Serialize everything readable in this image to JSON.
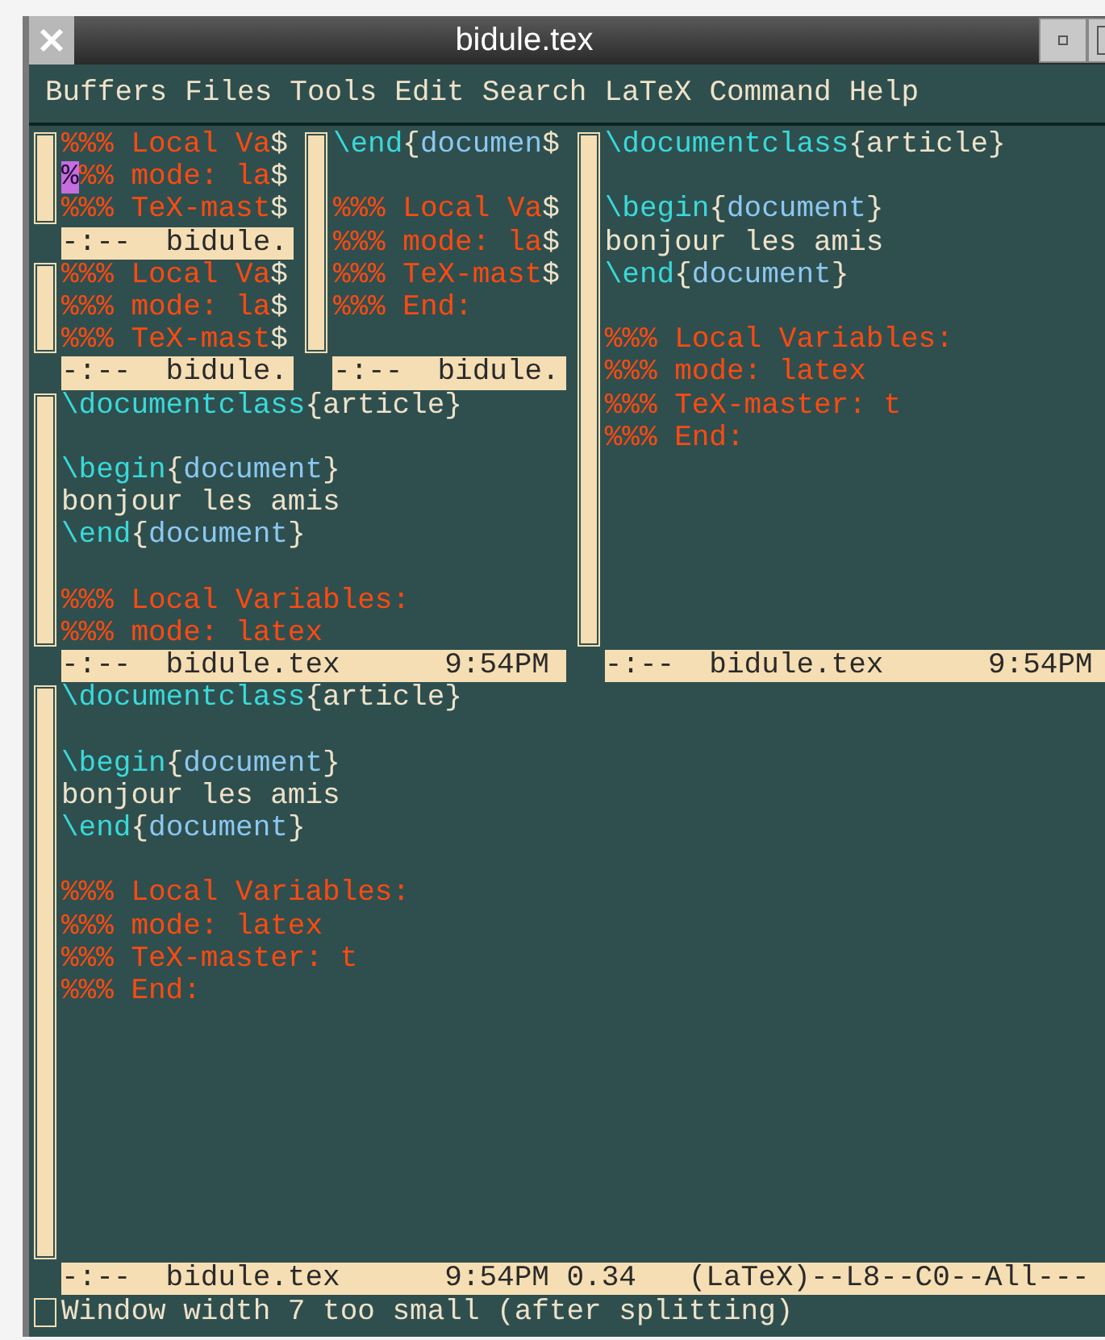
{
  "window": {
    "title": "bidule.tex"
  },
  "menu": [
    "Buffers",
    "Files",
    "Tools",
    "Edit",
    "Search",
    "LaTeX",
    "Command",
    "Help"
  ],
  "layout": {
    "kind": "rows",
    "children": [
      {
        "kind": "columns",
        "children": [
          {
            "kind": "rows",
            "children": [
              {
                "kind": "columns",
                "children": [
                  {
                    "kind": "rows",
                    "children": [
                      {
                        "kind": "window",
                        "modeline": "-:--  bidule.",
                        "lines": [
                          {
                            "kind": "text",
                            "segments": [
                              {
                                "kind": "comment",
                                "text": "%%% Local Va"
                              },
                              {
                                "kind": "plain",
                                "text": "$"
                              }
                            ]
                          },
                          {
                            "kind": "text",
                            "segments": [
                              {
                                "kind": "cursor",
                                "text": "%"
                              },
                              {
                                "kind": "comment",
                                "text": "%% mode: la"
                              },
                              {
                                "kind": "plain",
                                "text": "$"
                              }
                            ]
                          },
                          {
                            "kind": "text",
                            "segments": [
                              {
                                "kind": "comment",
                                "text": "%%% TeX-mast"
                              },
                              {
                                "kind": "plain",
                                "text": "$"
                              }
                            ]
                          }
                        ]
                      },
                      {
                        "kind": "window",
                        "modeline": "-:--  bidule.",
                        "lines": [
                          {
                            "kind": "text",
                            "segments": [
                              {
                                "kind": "comment",
                                "text": "%%% Local Va"
                              },
                              {
                                "kind": "plain",
                                "text": "$"
                              }
                            ]
                          },
                          {
                            "kind": "text",
                            "segments": [
                              {
                                "kind": "comment",
                                "text": "%%% mode: la"
                              },
                              {
                                "kind": "plain",
                                "text": "$"
                              }
                            ]
                          },
                          {
                            "kind": "text",
                            "segments": [
                              {
                                "kind": "comment",
                                "text": "%%% TeX-mast"
                              },
                              {
                                "kind": "plain",
                                "text": "$"
                              }
                            ]
                          }
                        ]
                      }
                    ]
                  },
                  {
                    "kind": "window",
                    "modeline": "-:--  bidule.",
                    "lines": [
                      {
                        "kind": "text",
                        "segments": [
                          {
                            "kind": "command",
                            "text": "\\end"
                          },
                          {
                            "kind": "plain",
                            "text": "{"
                          },
                          {
                            "kind": "argument",
                            "text": "documen"
                          },
                          {
                            "kind": "plain",
                            "text": "$"
                          }
                        ]
                      },
                      {
                        "kind": "blank"
                      },
                      {
                        "kind": "text",
                        "segments": [
                          {
                            "kind": "comment",
                            "text": "%%% Local Va"
                          },
                          {
                            "kind": "plain",
                            "text": "$"
                          }
                        ]
                      },
                      {
                        "kind": "text",
                        "segments": [
                          {
                            "kind": "comment",
                            "text": "%%% mode: la"
                          },
                          {
                            "kind": "plain",
                            "text": "$"
                          }
                        ]
                      },
                      {
                        "kind": "text",
                        "segments": [
                          {
                            "kind": "comment",
                            "text": "%%% TeX-mast"
                          },
                          {
                            "kind": "plain",
                            "text": "$"
                          }
                        ]
                      },
                      {
                        "kind": "text",
                        "segments": [
                          {
                            "kind": "comment",
                            "text": "%%% End:"
                          }
                        ]
                      }
                    ]
                  }
                ]
              },
              {
                "kind": "window",
                "modeline": "-:--  bidule.tex      9:54PM",
                "lines": [
                  {
                    "kind": "text",
                    "segments": [
                      {
                        "kind": "command",
                        "text": "\\documentclass"
                      },
                      {
                        "kind": "plain",
                        "text": "{article}"
                      }
                    ]
                  },
                  {
                    "kind": "blank"
                  },
                  {
                    "kind": "text",
                    "segments": [
                      {
                        "kind": "command",
                        "text": "\\begin"
                      },
                      {
                        "kind": "plain",
                        "text": "{"
                      },
                      {
                        "kind": "argument",
                        "text": "document"
                      },
                      {
                        "kind": "plain",
                        "text": "}"
                      }
                    ]
                  },
                  {
                    "kind": "text",
                    "segments": [
                      {
                        "kind": "plain",
                        "text": "bonjour les amis"
                      }
                    ]
                  },
                  {
                    "kind": "text",
                    "segments": [
                      {
                        "kind": "command",
                        "text": "\\end"
                      },
                      {
                        "kind": "plain",
                        "text": "{"
                      },
                      {
                        "kind": "argument",
                        "text": "document"
                      },
                      {
                        "kind": "plain",
                        "text": "}"
                      }
                    ]
                  },
                  {
                    "kind": "blank"
                  },
                  {
                    "kind": "text",
                    "segments": [
                      {
                        "kind": "comment",
                        "text": "%%% Local Variables:"
                      }
                    ]
                  },
                  {
                    "kind": "text",
                    "segments": [
                      {
                        "kind": "comment",
                        "text": "%%% mode: latex"
                      }
                    ]
                  }
                ]
              }
            ]
          },
          {
            "kind": "window",
            "modeline": "-:--  bidule.tex      9:54PM",
            "lines": [
              {
                "kind": "text",
                "segments": [
                  {
                    "kind": "command",
                    "text": "\\documentclass"
                  },
                  {
                    "kind": "plain",
                    "text": "{article}"
                  }
                ]
              },
              {
                "kind": "blank"
              },
              {
                "kind": "text",
                "segments": [
                  {
                    "kind": "command",
                    "text": "\\begin"
                  },
                  {
                    "kind": "plain",
                    "text": "{"
                  },
                  {
                    "kind": "argument",
                    "text": "document"
                  },
                  {
                    "kind": "plain",
                    "text": "}"
                  }
                ]
              },
              {
                "kind": "text",
                "segments": [
                  {
                    "kind": "plain",
                    "text": "bonjour les amis"
                  }
                ]
              },
              {
                "kind": "text",
                "segments": [
                  {
                    "kind": "command",
                    "text": "\\end"
                  },
                  {
                    "kind": "plain",
                    "text": "{"
                  },
                  {
                    "kind": "argument",
                    "text": "document"
                  },
                  {
                    "kind": "plain",
                    "text": "}"
                  }
                ]
              },
              {
                "kind": "blank"
              },
              {
                "kind": "text",
                "segments": [
                  {
                    "kind": "comment",
                    "text": "%%% Local Variables:"
                  }
                ]
              },
              {
                "kind": "text",
                "segments": [
                  {
                    "kind": "comment",
                    "text": "%%% mode: latex"
                  }
                ]
              },
              {
                "kind": "text",
                "segments": [
                  {
                    "kind": "comment",
                    "text": "%%% TeX-master: t"
                  }
                ]
              },
              {
                "kind": "text",
                "segments": [
                  {
                    "kind": "comment",
                    "text": "%%% End:"
                  }
                ]
              }
            ]
          }
        ]
      },
      {
        "kind": "window",
        "modeline": "-:--  bidule.tex      9:54PM 0.34   (LaTeX)--L8--C0--All---",
        "lines": [
          {
            "kind": "text",
            "segments": [
              {
                "kind": "command",
                "text": "\\documentclass"
              },
              {
                "kind": "plain",
                "text": "{article}"
              }
            ]
          },
          {
            "kind": "blank"
          },
          {
            "kind": "text",
            "segments": [
              {
                "kind": "command",
                "text": "\\begin"
              },
              {
                "kind": "plain",
                "text": "{"
              },
              {
                "kind": "argument",
                "text": "document"
              },
              {
                "kind": "plain",
                "text": "}"
              }
            ]
          },
          {
            "kind": "text",
            "segments": [
              {
                "kind": "plain",
                "text": "bonjour les amis"
              }
            ]
          },
          {
            "kind": "text",
            "segments": [
              {
                "kind": "command",
                "text": "\\end"
              },
              {
                "kind": "plain",
                "text": "{"
              },
              {
                "kind": "argument",
                "text": "document"
              },
              {
                "kind": "plain",
                "text": "}"
              }
            ]
          },
          {
            "kind": "blank"
          },
          {
            "kind": "text",
            "segments": [
              {
                "kind": "comment",
                "text": "%%% Local Variables:"
              }
            ]
          },
          {
            "kind": "text",
            "segments": [
              {
                "kind": "comment",
                "text": "%%% mode: latex"
              }
            ]
          },
          {
            "kind": "text",
            "segments": [
              {
                "kind": "comment",
                "text": "%%% TeX-master: t"
              }
            ]
          },
          {
            "kind": "text",
            "segments": [
              {
                "kind": "comment",
                "text": "%%% End:"
              }
            ]
          }
        ]
      }
    ]
  },
  "minibuffer": "Window width 7 too small (after splitting)"
}
